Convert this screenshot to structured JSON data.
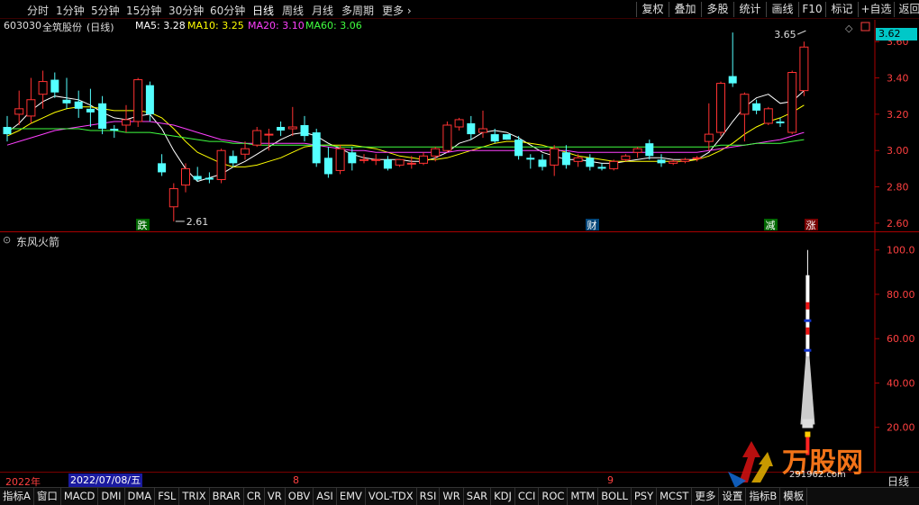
{
  "toolbar": {
    "periods": [
      "分时",
      "1分钟",
      "5分钟",
      "15分钟",
      "30分钟",
      "60分钟",
      "日线",
      "周线",
      "月线",
      "多周期",
      "更多"
    ],
    "active_period": "日线",
    "right_buttons": [
      "复权",
      "叠加",
      "多股",
      "统计",
      "画线",
      "F10",
      "标记",
      "+自选",
      "返回"
    ]
  },
  "stock": {
    "code": "603030",
    "name": "全筑股份",
    "period_label": "(日线)",
    "ma": [
      {
        "label": "MA5: 3.28",
        "color": "#ffffff"
      },
      {
        "label": "MA10: 3.25",
        "color": "#ffff00"
      },
      {
        "label": "MA20: 3.10",
        "color": "#ff40ff"
      },
      {
        "label": "MA60: 3.06",
        "color": "#40ff40"
      }
    ],
    "current_price": "3.62"
  },
  "main_axis": {
    "ticks": [
      "3.60",
      "3.40",
      "3.20",
      "3.00",
      "2.80",
      "2.60"
    ],
    "ylim": [
      2.55,
      3.72
    ]
  },
  "annotations": {
    "high_label": "3.65",
    "low_label": "2.61"
  },
  "markers": [
    {
      "text": "跌",
      "bg": "#006600",
      "color": "#ffffff"
    },
    {
      "text": "财",
      "bg": "#004477",
      "color": "#ffffff"
    },
    {
      "text": "减",
      "bg": "#006600",
      "color": "#ffffff"
    },
    {
      "text": "涨",
      "bg": "#770000",
      "color": "#ffffff"
    }
  ],
  "sub_indicator": {
    "name": "东风火箭",
    "ticks": [
      "100.0",
      "80.00",
      "60.00",
      "40.00",
      "20.00"
    ],
    "ylim": [
      0,
      108
    ]
  },
  "datebar": {
    "year": "2022年",
    "selected": "2022/07/08/五",
    "months": [
      "8",
      "9"
    ],
    "right_label": "日线"
  },
  "tabs": [
    "指标A",
    "窗口",
    "MACD",
    "DMI",
    "DMA",
    "FSL",
    "TRIX",
    "BRAR",
    "CR",
    "VR",
    "OBV",
    "ASI",
    "EMV",
    "VOL-TDX",
    "RSI",
    "WR",
    "SAR",
    "KDJ",
    "CCI",
    "ROC",
    "MTM",
    "BOLL",
    "PSY",
    "MCST",
    "更多",
    "设置",
    "指标B",
    "模板"
  ],
  "watermark": {
    "text": "万股网",
    "url": "291962.com"
  },
  "chart_data": {
    "type": "candlestick",
    "candles": [
      [
        3.13,
        3.19,
        3.09,
        3.05
      ],
      [
        3.2,
        3.33,
        3.23,
        3.14
      ],
      [
        3.19,
        3.4,
        3.28,
        3.15
      ],
      [
        3.31,
        3.44,
        3.38,
        3.23
      ],
      [
        3.39,
        3.43,
        3.32,
        3.29
      ],
      [
        3.28,
        3.4,
        3.26,
        3.23
      ],
      [
        3.27,
        3.33,
        3.23,
        3.18
      ],
      [
        3.23,
        3.34,
        3.21,
        3.13
      ],
      [
        3.26,
        3.3,
        3.12,
        3.09
      ],
      [
        3.12,
        3.14,
        3.11,
        3.07
      ],
      [
        3.14,
        3.25,
        3.17,
        3.1
      ],
      [
        3.16,
        3.4,
        3.39,
        3.13
      ],
      [
        3.36,
        3.38,
        3.2,
        3.16
      ],
      [
        2.93,
        2.98,
        2.88,
        2.86
      ],
      [
        2.69,
        2.82,
        2.79,
        2.61
      ],
      [
        2.81,
        2.93,
        2.9,
        2.77
      ],
      [
        2.86,
        2.91,
        2.84,
        2.83
      ],
      [
        2.85,
        2.88,
        2.84,
        2.82
      ],
      [
        2.84,
        3.01,
        3.0,
        2.82
      ],
      [
        2.97,
        3.0,
        2.93,
        2.91
      ],
      [
        2.98,
        3.05,
        3.01,
        2.95
      ],
      [
        3.03,
        3.13,
        3.11,
        3.02
      ],
      [
        3.09,
        3.12,
        3.09,
        3.0
      ],
      [
        3.13,
        3.16,
        3.11,
        3.08
      ],
      [
        3.12,
        3.24,
        3.13,
        3.08
      ],
      [
        3.14,
        3.19,
        3.08,
        3.05
      ],
      [
        3.1,
        3.12,
        2.93,
        2.91
      ],
      [
        2.96,
        3.02,
        2.87,
        2.85
      ],
      [
        2.89,
        3.03,
        3.01,
        2.87
      ],
      [
        2.99,
        3.02,
        2.93,
        2.89
      ],
      [
        2.95,
        2.98,
        2.95,
        2.93
      ],
      [
        2.95,
        2.98,
        2.95,
        2.92
      ],
      [
        2.95,
        2.97,
        2.9,
        2.89
      ],
      [
        2.92,
        2.95,
        2.95,
        2.91
      ],
      [
        2.93,
        2.97,
        2.93,
        2.9
      ],
      [
        2.93,
        2.99,
        2.97,
        2.92
      ],
      [
        2.97,
        3.02,
        3.01,
        2.94
      ],
      [
        3.0,
        3.16,
        3.14,
        2.99
      ],
      [
        3.13,
        3.18,
        3.17,
        3.11
      ],
      [
        3.15,
        3.19,
        3.09,
        3.06
      ],
      [
        3.1,
        3.22,
        3.12,
        3.07
      ],
      [
        3.09,
        3.12,
        3.05,
        3.04
      ],
      [
        3.09,
        3.09,
        3.06,
        3.06
      ],
      [
        3.06,
        3.08,
        2.97,
        2.95
      ],
      [
        2.96,
        2.98,
        2.95,
        2.9
      ],
      [
        2.95,
        2.98,
        2.91,
        2.89
      ],
      [
        2.92,
        3.03,
        3.01,
        2.86
      ],
      [
        2.99,
        3.03,
        2.92,
        2.9
      ],
      [
        2.94,
        2.98,
        2.96,
        2.91
      ],
      [
        2.96,
        2.98,
        2.91,
        2.89
      ],
      [
        2.91,
        2.93,
        2.9,
        2.89
      ],
      [
        2.9,
        2.95,
        2.94,
        2.89
      ],
      [
        2.95,
        2.98,
        2.97,
        2.94
      ],
      [
        2.99,
        3.02,
        3.01,
        2.96
      ],
      [
        3.04,
        3.06,
        2.97,
        2.95
      ],
      [
        2.95,
        2.98,
        2.93,
        2.91
      ],
      [
        2.93,
        2.95,
        2.94,
        2.92
      ],
      [
        2.94,
        2.96,
        2.95,
        2.93
      ],
      [
        2.96,
        2.97,
        2.96,
        2.94
      ],
      [
        3.05,
        3.26,
        3.09,
        3.0
      ],
      [
        3.1,
        3.38,
        3.37,
        3.08
      ],
      [
        3.41,
        3.65,
        3.37,
        3.35
      ],
      [
        3.2,
        3.32,
        3.31,
        3.05
      ],
      [
        3.26,
        3.28,
        3.22,
        3.2
      ],
      [
        3.15,
        3.24,
        3.23,
        3.14
      ],
      [
        3.16,
        3.18,
        3.15,
        3.13
      ],
      [
        3.1,
        3.44,
        3.43,
        3.09
      ],
      [
        3.33,
        3.6,
        3.57,
        3.3
      ]
    ],
    "ma_series": [
      {
        "name": "MA5",
        "color": "#ffffff",
        "values": [
          3.1,
          3.15,
          3.22,
          3.27,
          3.3,
          3.29,
          3.28,
          3.25,
          3.21,
          3.18,
          3.17,
          3.19,
          3.2,
          3.12,
          3.0,
          2.9,
          2.83,
          2.85,
          2.87,
          2.91,
          2.94,
          2.98,
          3.02,
          3.06,
          3.09,
          3.1,
          3.08,
          3.04,
          3.01,
          2.98,
          2.96,
          2.95,
          2.95,
          2.95,
          2.94,
          2.94,
          2.96,
          2.99,
          3.04,
          3.06,
          3.1,
          3.11,
          3.1,
          3.07,
          3.03,
          2.99,
          2.97,
          2.95,
          2.95,
          2.94,
          2.93,
          2.93,
          2.94,
          2.95,
          2.96,
          2.96,
          2.95,
          2.95,
          2.95,
          2.99,
          3.07,
          3.16,
          3.24,
          3.29,
          3.31,
          3.26,
          3.27,
          3.33
        ]
      },
      {
        "name": "MA10",
        "color": "#ffff00",
        "values": [
          3.08,
          3.11,
          3.15,
          3.18,
          3.21,
          3.23,
          3.24,
          3.24,
          3.23,
          3.22,
          3.22,
          3.22,
          3.21,
          3.18,
          3.12,
          3.05,
          2.99,
          2.96,
          2.93,
          2.91,
          2.91,
          2.92,
          2.94,
          2.96,
          2.99,
          3.02,
          3.03,
          3.03,
          3.03,
          3.03,
          3.02,
          3.01,
          2.99,
          2.97,
          2.96,
          2.95,
          2.95,
          2.96,
          2.98,
          3.0,
          3.02,
          3.04,
          3.05,
          3.05,
          3.04,
          3.03,
          3.01,
          2.99,
          2.97,
          2.96,
          2.95,
          2.94,
          2.94,
          2.94,
          2.94,
          2.94,
          2.94,
          2.94,
          2.95,
          2.97,
          3.0,
          3.04,
          3.09,
          3.13,
          3.16,
          3.18,
          3.21,
          3.25
        ]
      },
      {
        "name": "MA20",
        "color": "#ff40ff",
        "values": [
          3.03,
          3.05,
          3.07,
          3.09,
          3.11,
          3.12,
          3.13,
          3.14,
          3.15,
          3.16,
          3.16,
          3.16,
          3.16,
          3.15,
          3.14,
          3.12,
          3.1,
          3.08,
          3.06,
          3.05,
          3.04,
          3.04,
          3.04,
          3.04,
          3.04,
          3.04,
          3.03,
          3.02,
          3.01,
          3.0,
          3.0,
          2.99,
          2.99,
          2.99,
          2.99,
          2.99,
          2.99,
          2.99,
          3.0,
          3.0,
          3.0,
          3.0,
          3.0,
          3.0,
          3.0,
          3.0,
          3.0,
          3.0,
          2.99,
          2.99,
          2.99,
          2.99,
          2.99,
          2.99,
          2.99,
          2.99,
          2.99,
          2.99,
          2.99,
          3.0,
          3.01,
          3.02,
          3.03,
          3.04,
          3.05,
          3.06,
          3.08,
          3.1
        ]
      },
      {
        "name": "MA60",
        "color": "#40ff40",
        "values": [
          3.12,
          3.12,
          3.12,
          3.12,
          3.12,
          3.12,
          3.12,
          3.11,
          3.11,
          3.11,
          3.1,
          3.1,
          3.1,
          3.09,
          3.08,
          3.07,
          3.06,
          3.05,
          3.05,
          3.04,
          3.04,
          3.03,
          3.03,
          3.03,
          3.03,
          3.03,
          3.03,
          3.03,
          3.02,
          3.02,
          3.02,
          3.02,
          3.02,
          3.02,
          3.02,
          3.02,
          3.02,
          3.02,
          3.02,
          3.02,
          3.02,
          3.02,
          3.02,
          3.02,
          3.02,
          3.02,
          3.02,
          3.02,
          3.02,
          3.02,
          3.02,
          3.02,
          3.02,
          3.02,
          3.02,
          3.02,
          3.02,
          3.02,
          3.02,
          3.02,
          3.03,
          3.03,
          3.03,
          3.04,
          3.04,
          3.04,
          3.05,
          3.06
        ]
      }
    ],
    "rocket": {
      "bar_index": 67,
      "top_value": 100,
      "bottom_value": 14
    }
  }
}
